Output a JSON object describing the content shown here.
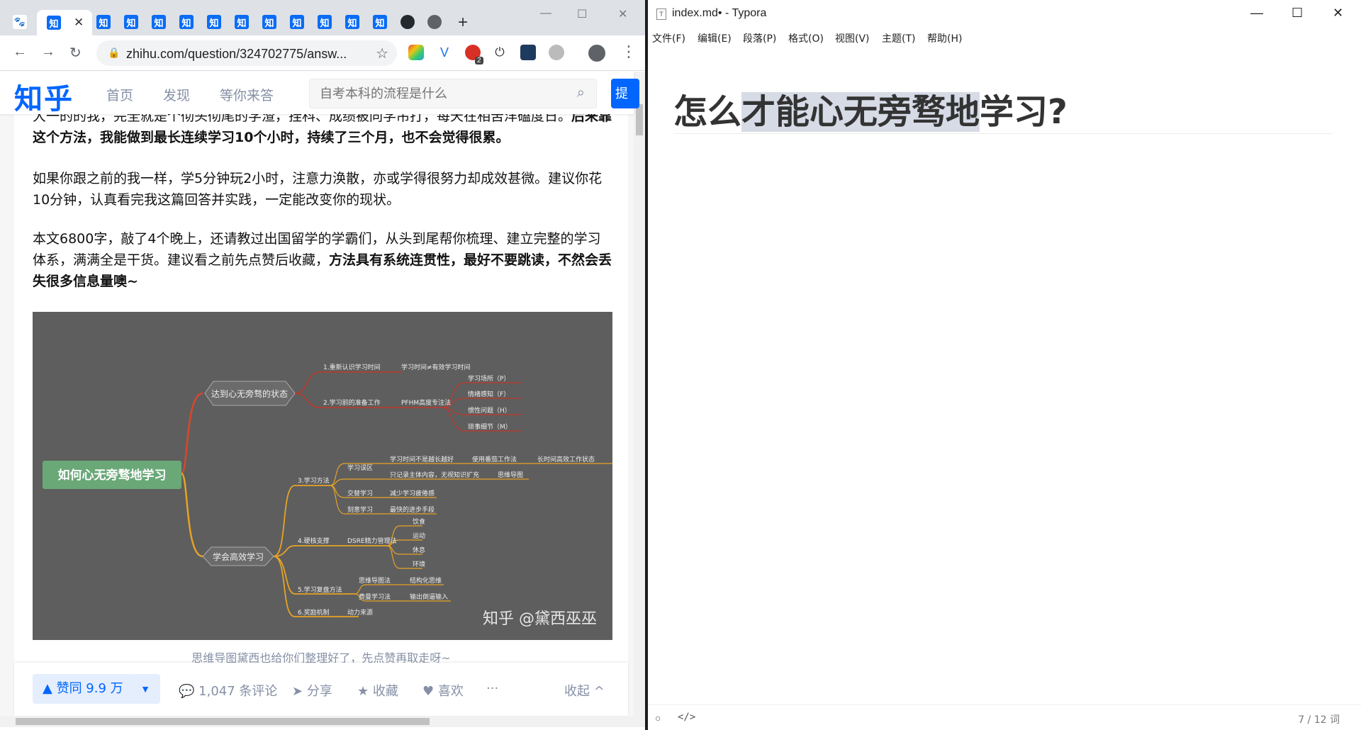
{
  "chrome": {
    "tab_favicon_text": "知",
    "tab_close": "✕",
    "new_tab": "+",
    "url": "zhihu.com/question/324702775/answ...",
    "window_controls": [
      "—",
      "☐",
      "✕"
    ]
  },
  "zhihu": {
    "logo": "知乎",
    "nav": [
      "首页",
      "发现",
      "等你来答"
    ],
    "search_placeholder": "自考本科的流程是什么",
    "ask_button": "提",
    "article": {
      "para0_line1": "大一的的我，完全就是个彻头彻尾的学渣，挂科、成绩被同学吊打，每天在相苦洋磕度日。",
      "para0_line1_bold": "后来靠",
      "para0_line2_bold": "这个方法，我能做到最长连续学习10个小时，持续了三个月，也不会觉得很累。",
      "para1": "如果你跟之前的我一样，学5分钟玩2小时，注意力涣散，亦或学得很努力却成效甚微。建议你花10分钟，认真看完我这篇回答并实践，一定能改变你的现状。",
      "para2_plain": "本文6800字，敲了4个晚上，还请教过出国留学的学霸们，从头到尾帮你梳理、建立完整的学习体系，满满全是干货。建议看之前先点赞后收藏，",
      "para2_bold": "方法具有系统连贯性，最好不要跳读，不然会丢失很多信息量噢~",
      "caption": "思维导图黛西也给你们整理好了，先点赞再取走呀~"
    },
    "mindmap": {
      "root": "如何心无旁骛地学习",
      "branch1": "达到心无旁骛的状态",
      "b1_1": "1.重新认识学习时间",
      "b1_1a": "学习时间≠有效学习时间",
      "b1_2": "2.学习前的准备工作",
      "b1_2a": "PFHM高度专注法",
      "b1_2_items": [
        "学习场所（P）",
        "情绪感知（F）",
        "惯性问题（H）",
        "琐事细节（M）"
      ],
      "branch2": "学会高效学习",
      "b2_1": "3.学习方法",
      "b2_1_items": [
        "学习误区",
        "交替学习",
        "刻意学习"
      ],
      "b2_1_sub": [
        "学习时间不是越长越好",
        "使用番茄工作法",
        "长时间高效工作状态",
        "只记录主体内容，无视知识扩充",
        "思维导图",
        "减少学习疲倦感",
        "最快的进步手段"
      ],
      "b2_2": "4.硬核支撑",
      "b2_2a": "DSRE精力管理法",
      "b2_2_items": [
        "饮食",
        "运动",
        "休息",
        "环境"
      ],
      "b2_3": "5.学习复盘方法",
      "b2_3_items": [
        "思维导图法",
        "费曼学习法"
      ],
      "b2_3_sub": [
        "结构化思维",
        "输出倒逼输入"
      ],
      "b2_4": "6.奖励机制",
      "b2_4a": "动力来源",
      "watermark": "知乎 @黛西巫巫"
    },
    "actions": {
      "vote": "▲ 赞同 9.9 万",
      "vote_down": "▼",
      "comments": "1,047 条评论",
      "share": "分享",
      "collect": "收藏",
      "like": "喜欢",
      "more": "···",
      "collapse": "收起"
    }
  },
  "typora": {
    "title": "index.md• - Typora",
    "menus": [
      "文件(F)",
      "编辑(E)",
      "段落(P)",
      "格式(O)",
      "视图(V)",
      "主题(T)",
      "帮助(H)"
    ],
    "heading_pre": "怎么",
    "heading_sel": "才能心无旁骛地",
    "heading_post": "学习?",
    "status_code": "</>",
    "word_count": "7 / 12 词",
    "window_controls": [
      "—",
      "☐",
      "✕"
    ]
  }
}
